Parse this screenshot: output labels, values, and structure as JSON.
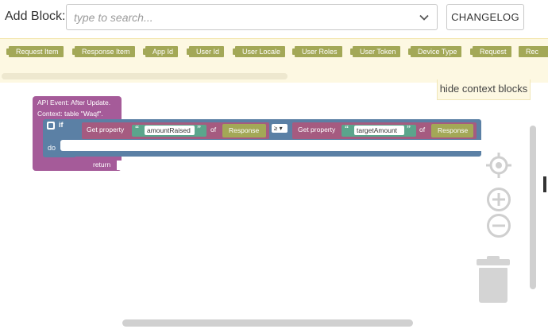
{
  "header": {
    "add_block_label": "Add Block:",
    "search_placeholder": "type to search...",
    "changelog_label": "CHANGELOG"
  },
  "context_bar": {
    "items": [
      "Request Item",
      "Response Item",
      "App Id",
      "User Id",
      "User Locale",
      "User Roles",
      "User Token",
      "Device Type",
      "Request",
      "Rec"
    ],
    "hide_label": "hide context blocks"
  },
  "workspace": {
    "event": {
      "line1": "API Event: After Update.",
      "line2": "Context: table \"Waqf\".",
      "return_label": "return"
    },
    "if_block": {
      "if_label": "if",
      "do_label": "do",
      "operator": "≥ ▾"
    },
    "left_get": {
      "label": "Get property",
      "property": "amountRaised",
      "of_label": "of",
      "target": "Response"
    },
    "right_get": {
      "label": "Get property",
      "property": "targetAmount",
      "of_label": "of",
      "target": "Response"
    }
  },
  "icons": {
    "search_dropdown": "chevron-down-icon",
    "recenter": "crosshair-icon",
    "zoom_in": "zoom-in-icon",
    "zoom_out": "zoom-out-icon",
    "trash": "trash-icon"
  },
  "colors": {
    "event_block": "#a55b99",
    "logic_block": "#5b80a5",
    "property_block": "#a55b80",
    "string_block": "#5ba58c",
    "context_block": "#a3a857",
    "context_bar_bg": "#fdf8e2"
  }
}
